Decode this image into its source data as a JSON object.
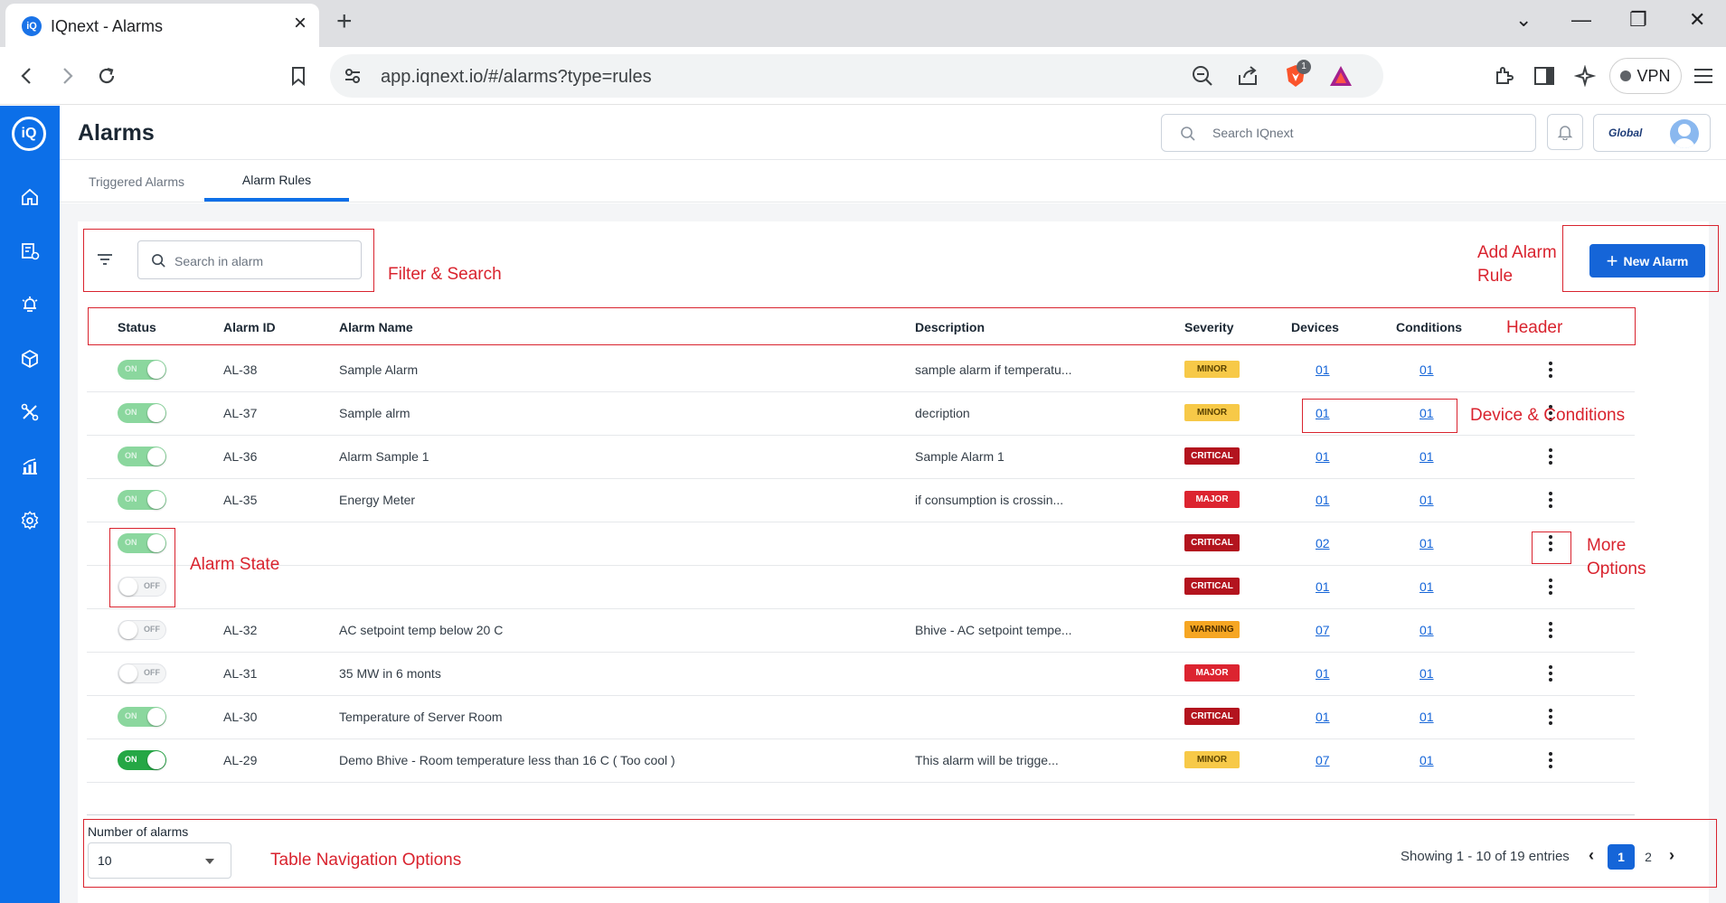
{
  "browser": {
    "tab_title": "IQnext - Alarms",
    "url": "app.iqnext.io/#/alarms?type=rules",
    "vpn_label": "VPN",
    "shield_badge": "1"
  },
  "app": {
    "logo_text": "iQ",
    "page_title": "Alarms",
    "global_search_placeholder": "Search IQnext",
    "org_logo": "Global"
  },
  "tabs": [
    {
      "label": "Triggered Alarms",
      "active": false
    },
    {
      "label": "Alarm Rules",
      "active": true
    }
  ],
  "toolbar": {
    "search_placeholder": "Search in alarm",
    "new_alarm_label": "New Alarm"
  },
  "table": {
    "headers": {
      "status": "Status",
      "alarm_id": "Alarm ID",
      "alarm_name": "Alarm Name",
      "description": "Description",
      "severity": "Severity",
      "devices": "Devices",
      "conditions": "Conditions"
    },
    "rows": [
      {
        "state": "on-light",
        "status_label": "ON",
        "id": "AL-38",
        "name": "Sample Alarm",
        "description": "sample alarm if temperatu...",
        "severity": "MINOR",
        "devices": "01",
        "conditions": "01"
      },
      {
        "state": "on-light",
        "status_label": "ON",
        "id": "AL-37",
        "name": "Sample alrm",
        "description": "decription",
        "severity": "MINOR",
        "devices": "01",
        "conditions": "01"
      },
      {
        "state": "on-light",
        "status_label": "ON",
        "id": "AL-36",
        "name": "Alarm Sample 1",
        "description": "Sample Alarm 1",
        "severity": "CRITICAL",
        "devices": "01",
        "conditions": "01"
      },
      {
        "state": "on-light",
        "status_label": "ON",
        "id": "AL-35",
        "name": "Energy Meter",
        "description": "if consumption is crossin...",
        "severity": "MAJOR",
        "devices": "01",
        "conditions": "01"
      },
      {
        "state": "on-light",
        "status_label": "ON",
        "id": "",
        "name": "",
        "description": "",
        "severity": "CRITICAL",
        "devices": "02",
        "conditions": "01"
      },
      {
        "state": "off",
        "status_label": "OFF",
        "id": "",
        "name": "",
        "description": "",
        "severity": "CRITICAL",
        "devices": "01",
        "conditions": "01"
      },
      {
        "state": "off",
        "status_label": "OFF",
        "id": "AL-32",
        "name": "AC setpoint temp below 20 C",
        "description": "Bhive - AC setpoint tempe...",
        "severity": "WARNING",
        "devices": "07",
        "conditions": "01"
      },
      {
        "state": "off",
        "status_label": "OFF",
        "id": "AL-31",
        "name": "35 MW in 6 monts",
        "description": "",
        "severity": "MAJOR",
        "devices": "01",
        "conditions": "01"
      },
      {
        "state": "on-light",
        "status_label": "ON",
        "id": "AL-30",
        "name": "Temperature of Server Room",
        "description": "",
        "severity": "CRITICAL",
        "devices": "01",
        "conditions": "01"
      },
      {
        "state": "on-dark",
        "status_label": "ON",
        "id": "AL-29",
        "name": "Demo Bhive - Room temperature less than 16 C ( Too cool )",
        "description": "This alarm will be trigge...",
        "severity": "MINOR",
        "devices": "07",
        "conditions": "01"
      }
    ]
  },
  "severity_colors": {
    "MINOR": {
      "bg": "#f7c948",
      "fg": "#5b4300"
    },
    "CRITICAL": {
      "bg": "#b3141e",
      "fg": "#ffffff"
    },
    "MAJOR": {
      "bg": "#dc2430",
      "fg": "#ffffff"
    },
    "WARNING": {
      "bg": "#f6a623",
      "fg": "#4a2c00"
    }
  },
  "footer": {
    "number_label": "Number of alarms",
    "page_size": "10",
    "showing_text": "Showing 1 - 10 of 19 entries",
    "pages": [
      "1",
      "2"
    ],
    "current_page": "1"
  },
  "annotations": {
    "filter_search": "Filter & Search",
    "add_alarm_rule": "Add Alarm\nRule",
    "header": "Header",
    "device_conditions": "Device & Conditions",
    "alarm_state": "Alarm State",
    "more_options": "More\nOptions",
    "table_navigation": "Table Navigation Options"
  },
  "colors": {
    "sidebar": "#0c6fe8",
    "primary": "#1565d8",
    "annotation": "#d9232e"
  }
}
